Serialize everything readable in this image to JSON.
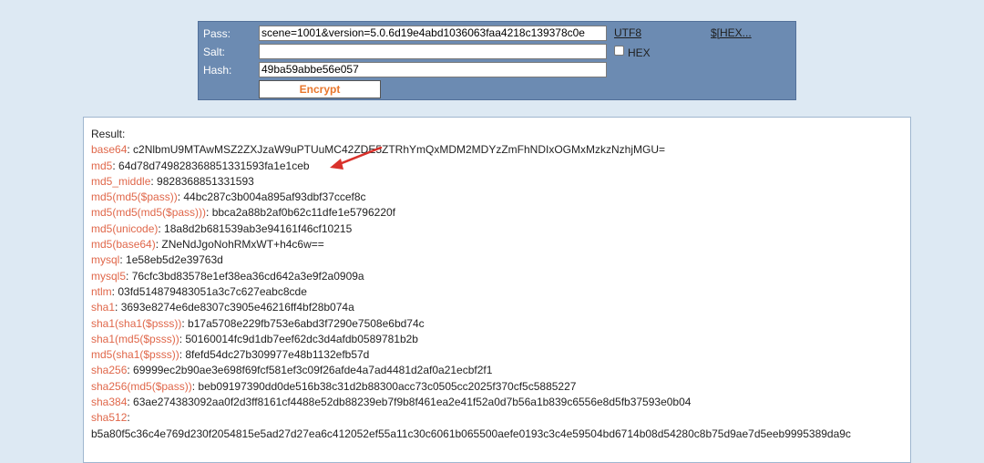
{
  "form": {
    "pass_label": "Pass:",
    "salt_label": "Salt:",
    "hash_label": "Hash:",
    "pass_value": "scene=1001&version=5.0.6d19e4abd1036063faa4218c139378c0e",
    "salt_value": "",
    "hash_value": "49ba59abbe56e057",
    "encrypt_label": "Encrypt",
    "utf8_link": "UTF8",
    "hex_label": "HEX",
    "hex_checked": false,
    "hex_link": "$[HEX..."
  },
  "result": {
    "title": "Result:",
    "rows": [
      {
        "key": "base64",
        "value": "c2NlbmU9MTAwMSZ2ZXJzaW9uPTUuMC42ZDE5ZTRhYmQxMDM2MDYzZmFhNDIxOGMxMzkzNzhjMGU="
      },
      {
        "key": "md5",
        "value": "64d78d749828368851331593fa1e1ceb"
      },
      {
        "key": "md5_middle",
        "value": "9828368851331593"
      },
      {
        "key": "md5(md5($pass))",
        "value": "44bc287c3b004a895af93dbf37ccef8c"
      },
      {
        "key": "md5(md5(md5($pass)))",
        "value": "bbca2a88b2af0b62c11dfe1e5796220f"
      },
      {
        "key": "md5(unicode)",
        "value": "18a8d2b681539ab3e94161f46cf10215"
      },
      {
        "key": "md5(base64)",
        "value": "ZNeNdJgoNohRMxWT+h4c6w=="
      },
      {
        "key": "mysql",
        "value": "1e58eb5d2e39763d"
      },
      {
        "key": "mysql5",
        "value": "76cfc3bd83578e1ef38ea36cd642a3e9f2a0909a"
      },
      {
        "key": "ntlm",
        "value": "03fd514879483051a3c7c627eabc8cde"
      },
      {
        "key": "sha1",
        "value": "3693e8274e6de8307c3905e46216ff4bf28b074a"
      },
      {
        "key": "sha1(sha1($psss))",
        "value": "b17a5708e229fb753e6abd3f7290e7508e6bd74c"
      },
      {
        "key": "sha1(md5($psss))",
        "value": "50160014fc9d1db7eef62dc3d4afdb0589781b2b"
      },
      {
        "key": "md5(sha1($psss))",
        "value": "8fefd54dc27b309977e48b1132efb57d"
      },
      {
        "key": "sha256",
        "value": "69999ec2b90ae3e698f69fcf581ef3c09f26afde4a7ad4481d2af0a21ecbf2f1"
      },
      {
        "key": "sha256(md5($pass))",
        "value": "beb09197390dd0de516b38c31d2b88300acc73c0505cc2025f370cf5c5885227"
      },
      {
        "key": "sha384",
        "value": "63ae274383092aa0f2d3ff8161cf4488e52db88239eb7f9b8f461ea2e41f52a0d7b56a1b839c6556e8d5fb37593e0b04"
      },
      {
        "key": "sha512",
        "value": ""
      }
    ],
    "sha512_value_line": "b5a80f5c36c4e769d230f2054815e5ad27d27ea6c412052ef55a11c30c6061b065500aefe0193c3c4e59504bd6714b08d54280c8b75d9ae7d5eeb9995389da9c"
  },
  "colors": {
    "panel_bg": "#6c8bb2",
    "key_color": "#e0674a",
    "encrypt_color": "#e8762c",
    "arrow_color": "#d9312b"
  }
}
